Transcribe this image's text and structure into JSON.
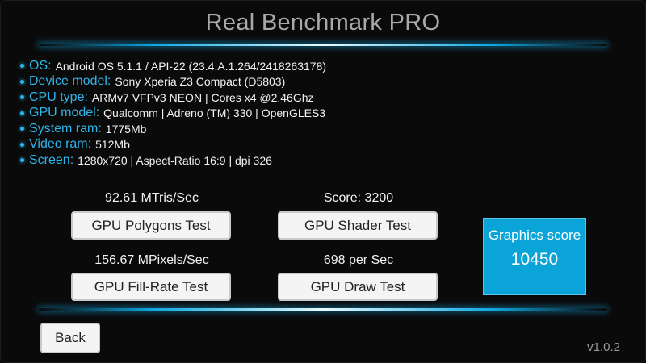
{
  "app": {
    "title": "Real Benchmark PRO",
    "version": "v1.0.2"
  },
  "info": [
    {
      "label": "OS:",
      "value": "Android OS 5.1.1 / API-22 (23.4.A.1.264/2418263178)"
    },
    {
      "label": "Device model:",
      "value": "Sony Xperia Z3 Compact (D5803)"
    },
    {
      "label": "CPU type:",
      "value": "ARMv7 VFPv3 NEON | Cores x4 @2.46Ghz"
    },
    {
      "label": "GPU model:",
      "value": "Qualcomm | Adreno (TM) 330 | OpenGLES3"
    },
    {
      "label": "System ram:",
      "value": "1775Mb"
    },
    {
      "label": "Video ram:",
      "value": "512Mb"
    },
    {
      "label": "Screen:",
      "value": "1280x720 | Aspect-Ratio 16:9 | dpi 326"
    }
  ],
  "tests": {
    "polygons": {
      "result": "92.61 MTris/Sec",
      "button": "GPU Polygons Test"
    },
    "shader": {
      "result": "Score: 3200",
      "button": "GPU Shader Test"
    },
    "fillrate": {
      "result": "156.67 MPixels/Sec",
      "button": "GPU Fill-Rate Test"
    },
    "draw": {
      "result": "698 per Sec",
      "button": "GPU Draw Test"
    }
  },
  "score": {
    "label": "Graphics score",
    "value": "10450"
  },
  "nav": {
    "back_label": "Back"
  },
  "colors": {
    "accent": "#2fb4e8",
    "score_bg": "#0aa4d9",
    "background": "#0a0a0a"
  },
  "icons": {
    "bullet": "bullet-dot-icon"
  }
}
